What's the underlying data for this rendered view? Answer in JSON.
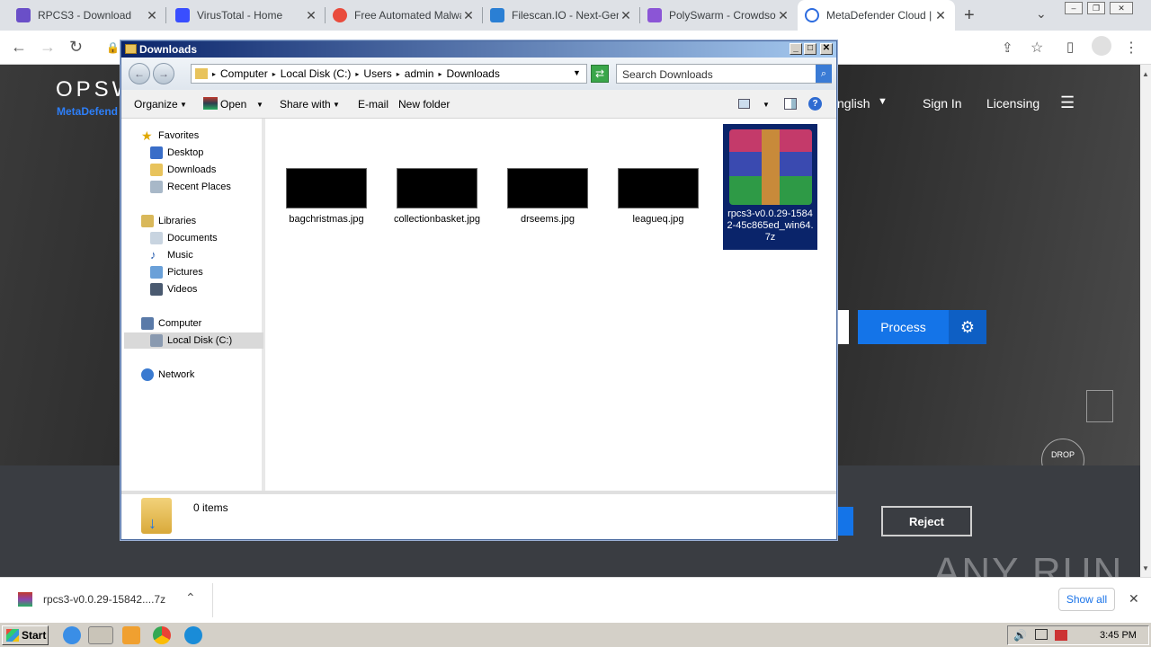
{
  "browser": {
    "tabs": [
      {
        "title": "RPCS3 - Download",
        "color": "#6a4fc8"
      },
      {
        "title": "VirusTotal - Home",
        "color": "#394eff"
      },
      {
        "title": "Free Automated Malwa",
        "color": "#e94b3c"
      },
      {
        "title": "Filescan.IO - Next-Gen",
        "color": "#2a7fd4"
      },
      {
        "title": "PolySwarm - Crowdsou",
        "color": "#8b55d6"
      },
      {
        "title": "MetaDefender Cloud |",
        "color": "#2d6cdf"
      }
    ],
    "new_tab": "+"
  },
  "website": {
    "logo": "OPSW",
    "logo_sub": "MetaDefend",
    "nav": {
      "language": "nglish",
      "signin": "Sign In",
      "licensing": "Licensing"
    },
    "process_label": "Process",
    "reject_label": "Reject",
    "drop_label": "DROP",
    "watermark": "ANY RUN"
  },
  "downloads_bar": {
    "file": "rpcs3-v0.0.29-15842....7z",
    "show_all": "Show all"
  },
  "taskbar": {
    "start": "Start",
    "time": "3:45 PM"
  },
  "explorer": {
    "title": "Downloads",
    "breadcrumb": [
      "Computer",
      "Local Disk (C:)",
      "Users",
      "admin",
      "Downloads"
    ],
    "search_placeholder": "Search Downloads",
    "commands": {
      "organize": "Organize",
      "open": "Open",
      "share": "Share with",
      "email": "E-mail",
      "new_folder": "New folder"
    },
    "nav": {
      "favorites": "Favorites",
      "desktop": "Desktop",
      "downloads": "Downloads",
      "recent": "Recent Places",
      "libraries": "Libraries",
      "documents": "Documents",
      "music": "Music",
      "pictures": "Pictures",
      "videos": "Videos",
      "computer": "Computer",
      "localdisk": "Local Disk (C:)",
      "network": "Network"
    },
    "files": [
      {
        "name": "bagchristmas.jpg"
      },
      {
        "name": "collectionbasket.jpg"
      },
      {
        "name": "drseems.jpg"
      },
      {
        "name": "leagueq.jpg"
      }
    ],
    "selected_file": "rpcs3-v0.0.29-15842-45c865ed_win64.7z",
    "status": "0 items"
  }
}
